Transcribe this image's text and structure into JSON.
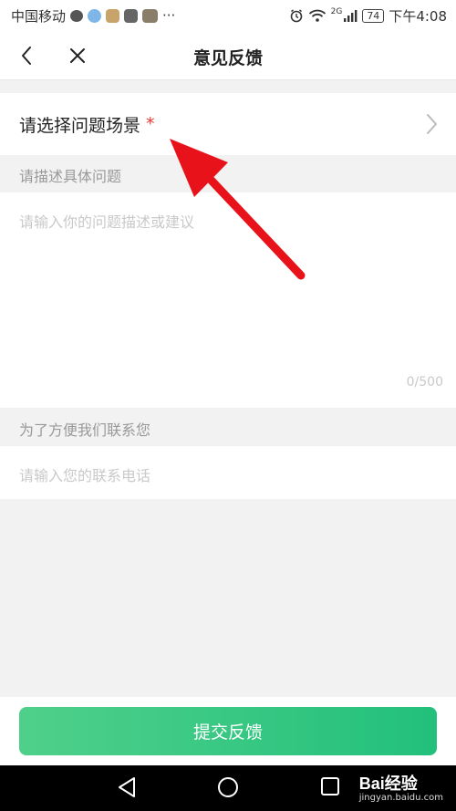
{
  "status_bar": {
    "carrier": "中国移动",
    "more": "···",
    "network": "2G",
    "battery": "74",
    "time": "下午4:08"
  },
  "header": {
    "title": "意见反馈",
    "back_icon": "chevron-left-icon",
    "close_icon": "close-icon"
  },
  "scene": {
    "label": "请选择问题场景",
    "required_mark": "*"
  },
  "description": {
    "section_label": "请描述具体问题",
    "placeholder": "请输入你的问题描述或建议",
    "char_count": "0/500"
  },
  "contact": {
    "section_label": "为了方便我们联系您",
    "placeholder": "请输入您的联系电话"
  },
  "submit": {
    "label": "提交反馈"
  },
  "watermark": {
    "brand": "Bai经验",
    "domain": "jingyan.baidu.com"
  },
  "colors": {
    "accent_start": "#4fd08a",
    "accent_end": "#22c07c",
    "required": "#e53935",
    "arrow": "#e8131a"
  }
}
